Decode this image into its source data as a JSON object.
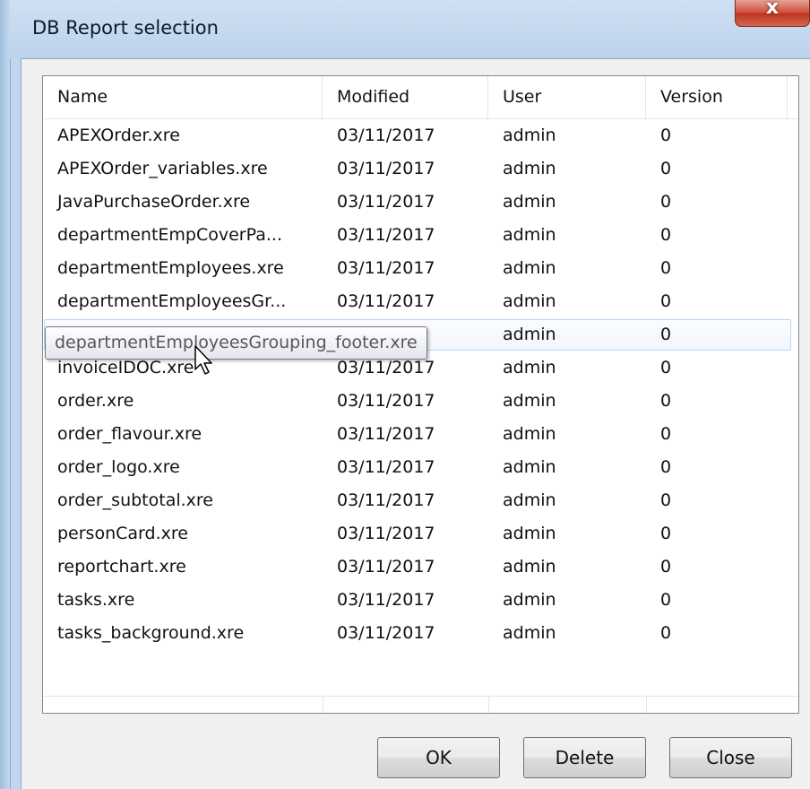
{
  "window": {
    "title": "DB Report selection"
  },
  "table": {
    "columns": [
      "Name",
      "Modified",
      "User",
      "Version"
    ],
    "rows": [
      [
        "APEXOrder.xre",
        "03/11/2017",
        "admin",
        "0"
      ],
      [
        "APEXOrder_variables.xre",
        "03/11/2017",
        "admin",
        "0"
      ],
      [
        "JavaPurchaseOrder.xre",
        "03/11/2017",
        "admin",
        "0"
      ],
      [
        "departmentEmpCoverPa...",
        "03/11/2017",
        "admin",
        "0"
      ],
      [
        "departmentEmployees.xre",
        "03/11/2017",
        "admin",
        "0"
      ],
      [
        "departmentEmployeesGr...",
        "03/11/2017",
        "admin",
        "0"
      ],
      [
        "",
        "",
        "admin",
        "0"
      ],
      [
        "invoiceIDOC.xre",
        "03/11/2017",
        "admin",
        "0"
      ],
      [
        "order.xre",
        "03/11/2017",
        "admin",
        "0"
      ],
      [
        "order_flavour.xre",
        "03/11/2017",
        "admin",
        "0"
      ],
      [
        "order_logo.xre",
        "03/11/2017",
        "admin",
        "0"
      ],
      [
        "order_subtotal.xre",
        "03/11/2017",
        "admin",
        "0"
      ],
      [
        "personCard.xre",
        "03/11/2017",
        "admin",
        "0"
      ],
      [
        "reportchart.xre",
        "03/11/2017",
        "admin",
        "0"
      ],
      [
        "tasks.xre",
        "03/11/2017",
        "admin",
        "0"
      ],
      [
        "tasks_background.xre",
        "03/11/2017",
        "admin",
        "0"
      ]
    ],
    "hover_row_index": 6
  },
  "tooltip": {
    "text": "departmentEmployeesGrouping_footer.xre"
  },
  "buttons": {
    "ok": "OK",
    "delete": "Delete",
    "close": "Close"
  },
  "titlebar_close_glyph": "x",
  "colors": {
    "titlebar": "#bfd6ee",
    "close_button": "#c7402b",
    "dialog": "#f0f0f0",
    "hover_border": "#b8d6fb"
  }
}
